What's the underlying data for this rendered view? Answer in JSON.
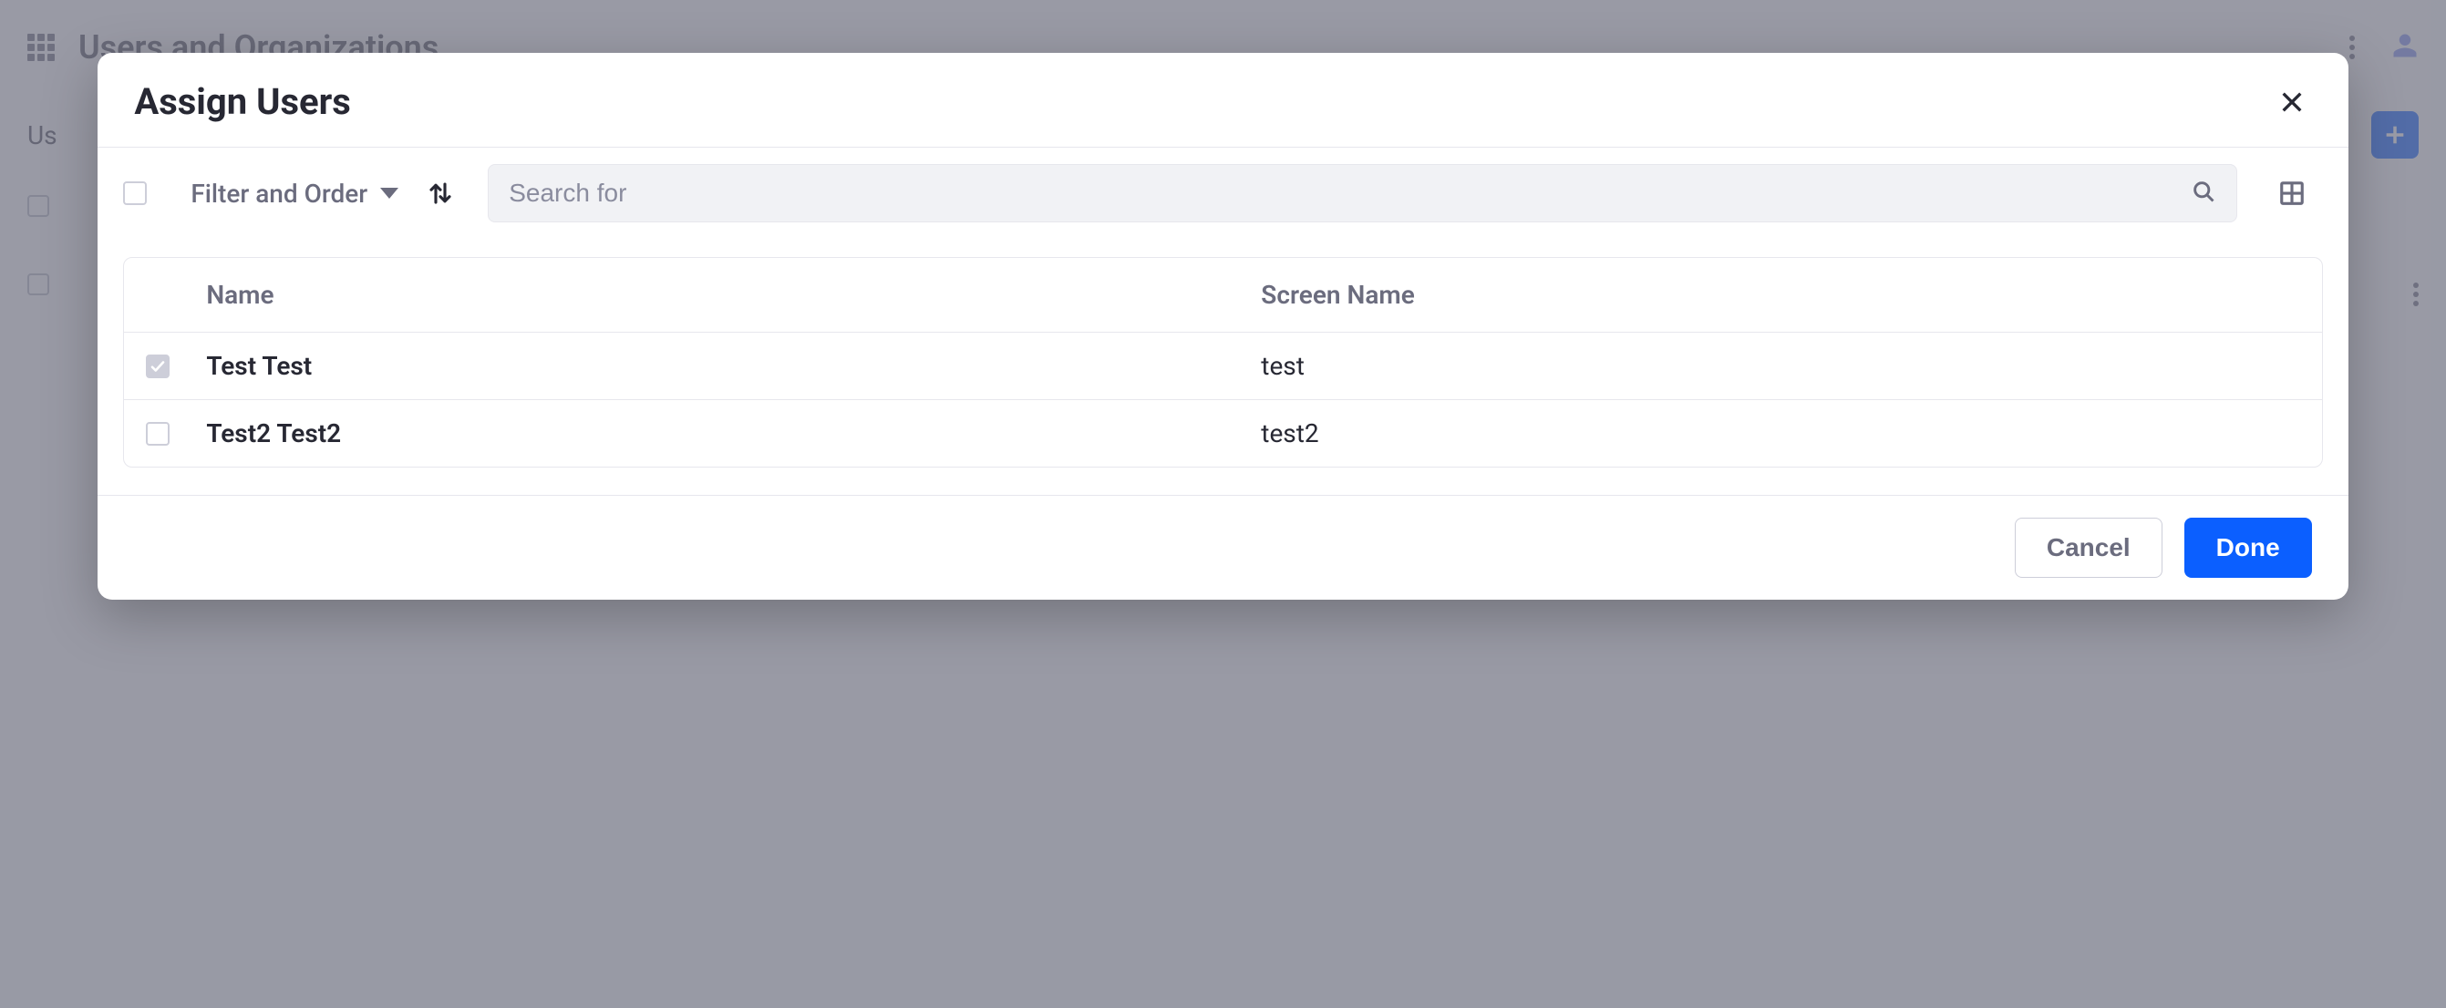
{
  "background": {
    "page_title": "Users and Organizations",
    "truncated_tab": "Us"
  },
  "modal": {
    "title": "Assign Users",
    "toolbar": {
      "filter_label": "Filter and Order",
      "search_placeholder": "Search for"
    },
    "table": {
      "columns": {
        "name": "Name",
        "screen_name": "Screen Name"
      },
      "rows": [
        {
          "checked": true,
          "name": "Test Test",
          "screen_name": "test"
        },
        {
          "checked": false,
          "name": "Test2 Test2",
          "screen_name": "test2"
        }
      ]
    },
    "footer": {
      "cancel": "Cancel",
      "done": "Done"
    }
  }
}
